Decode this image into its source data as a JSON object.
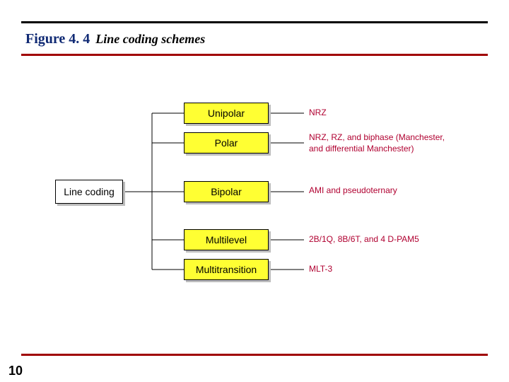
{
  "figure_number": "Figure 4. 4",
  "figure_caption": "Line coding schemes",
  "page_number": "10",
  "root": {
    "label": "Line coding"
  },
  "categories": [
    {
      "label": "Unipolar",
      "desc": "NRZ"
    },
    {
      "label": "Polar",
      "desc": "NRZ, RZ, and biphase (Manchester,",
      "desc2": "and differential Manchester)"
    },
    {
      "label": "Bipolar",
      "desc": "AMI and pseudoternary"
    },
    {
      "label": "Multilevel",
      "desc": "2B/1Q,  8B/6T,  and 4 D-PAM5"
    },
    {
      "label": "Multitransition",
      "desc": "MLT-3"
    }
  ]
}
